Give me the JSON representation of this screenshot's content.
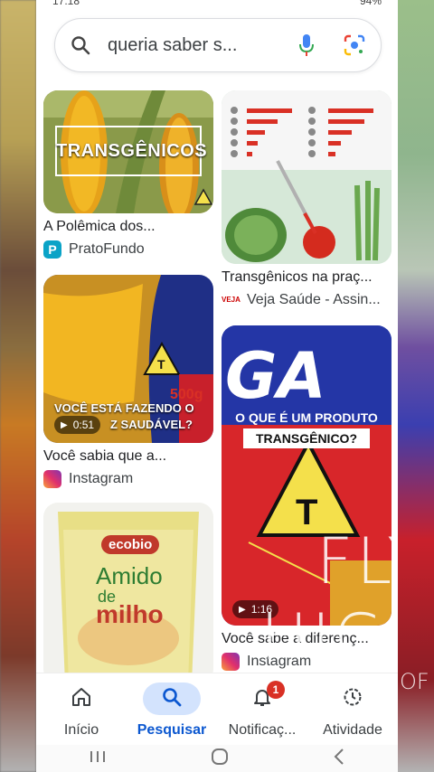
{
  "status": {
    "time": "17:18",
    "battery": "94%"
  },
  "search": {
    "query": "queria saber s..."
  },
  "results": [
    {
      "id": "r1",
      "title": "A Polêmica dos...",
      "source": "PratoFundo",
      "overlay": "TRANSGÊNICOS"
    },
    {
      "id": "r2",
      "title": "Transgênicos na praç...",
      "source": "Veja Saúde - Assin..."
    },
    {
      "id": "r3",
      "title": "Você sabia que a...",
      "source": "Instagram",
      "duration": "0:51",
      "overlay_line1": "VOCÊ ESTÁ FAZENDO O",
      "overlay_line2": "Z SAUDÁVEL?",
      "pack_weight": "500g"
    },
    {
      "id": "r4",
      "title": "Você sabe a diferenç...",
      "source": "Instagram",
      "duration": "1:16",
      "overlay_line1": "O QUE É UM PRODUTO",
      "overlay_line2": "TRANSGÊNICO?"
    },
    {
      "id": "r5",
      "brand": "ecobio",
      "product_line1": "Amido",
      "product_line2": "de",
      "product_line3": "milho"
    }
  ],
  "nav": {
    "home": "Início",
    "search": "Pesquisar",
    "notifications": "Notificaç...",
    "notif_count": "1",
    "activity": "Atividade"
  },
  "colors": {
    "accent": "#0b57d0",
    "active_pill": "#d3e3fd",
    "badge": "#d93025"
  },
  "overlay_watermark": {
    "word1": "FLY",
    "word2": "HIGH",
    "side_right": "OF"
  }
}
